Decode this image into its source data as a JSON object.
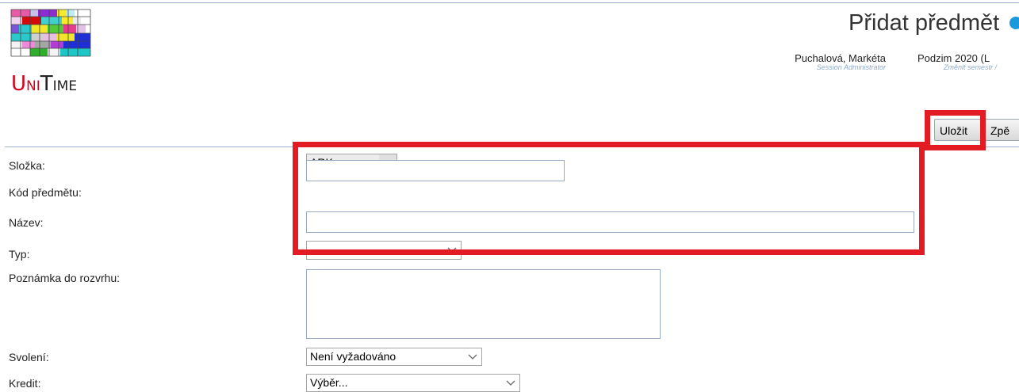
{
  "logo": {
    "text_U": "U",
    "text_NI": "NI",
    "text_T": "T",
    "text_IME": "IME"
  },
  "header": {
    "title": "Přidat předmět",
    "user_name": "Puchalová, Markéta",
    "user_role": "Session Administrator",
    "session": "Podzim 2020 (L",
    "session_link": "Změnit semestr /"
  },
  "toolbar": {
    "save_label": "Uložit",
    "back_label": "Zpě"
  },
  "form": {
    "department_label": "Složka:",
    "department_value": "ARK",
    "course_code_label": "Kód předmětu:",
    "course_code_value": "",
    "name_label": "Název:",
    "name_value": "",
    "type_label": "Typ:",
    "note_label": "Poznámka do rozvrhu:",
    "note_value": "",
    "consent_label": "Svolení:",
    "consent_value": "Není vyžadováno",
    "credit_label": "Kredit:",
    "credit_value": "Výběr..."
  },
  "colors": {
    "highlight": "#e31b23",
    "rule": "#9cb0ce",
    "help": "#1a9adc"
  }
}
